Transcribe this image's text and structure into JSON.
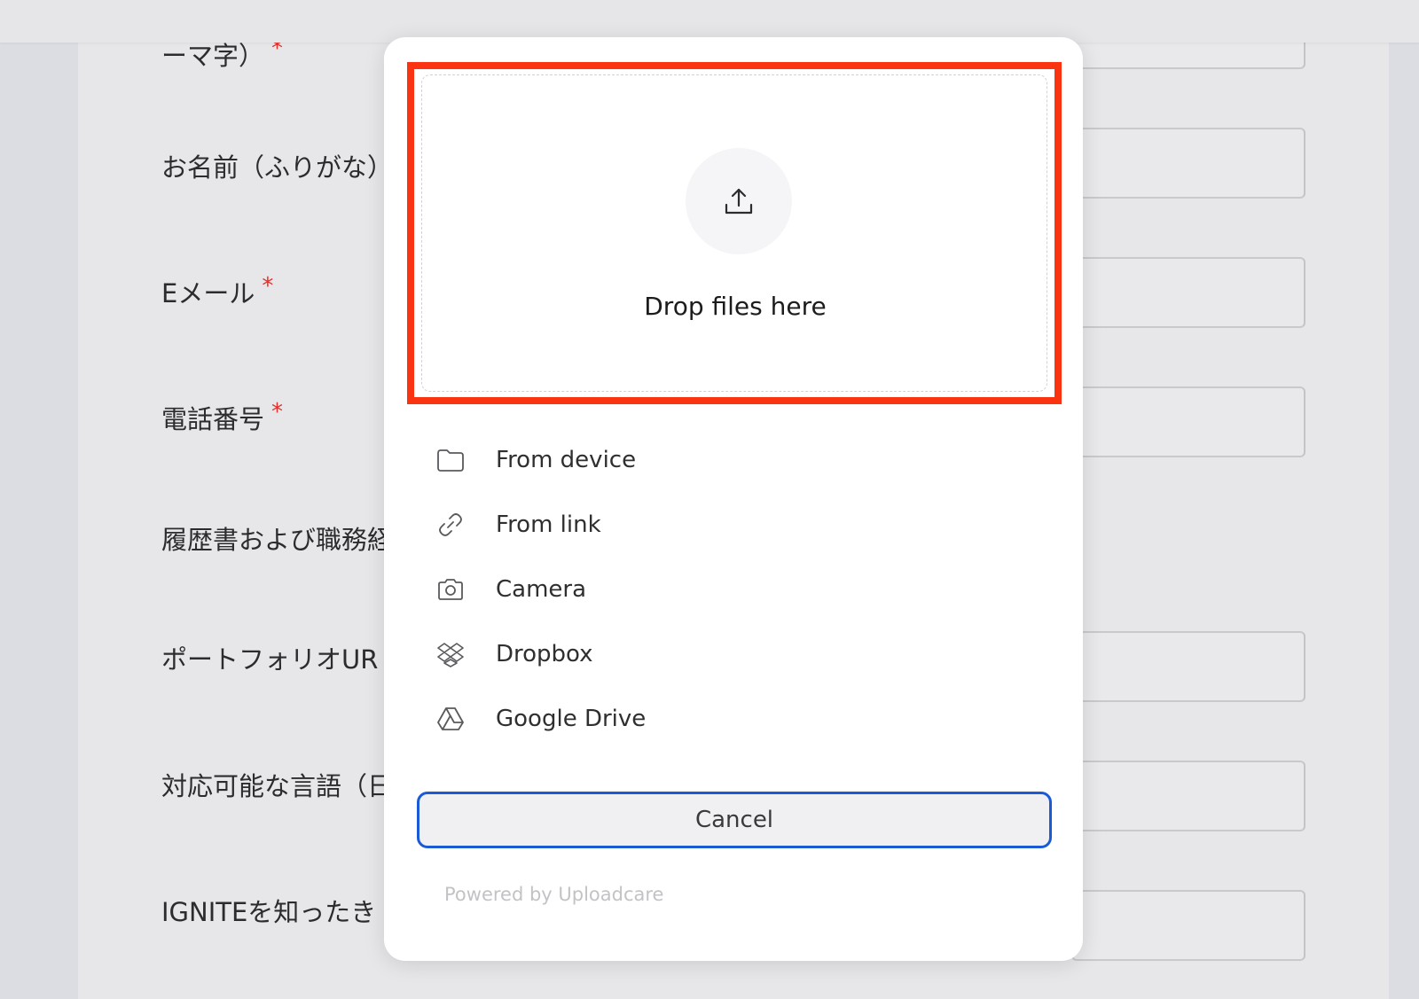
{
  "form": {
    "labels": [
      {
        "text": "ーマ字）",
        "required": true
      },
      {
        "text": "お名前（ふりがな）",
        "required": false
      },
      {
        "text": "Eメール",
        "required": true
      },
      {
        "text": "電話番号",
        "required": true
      },
      {
        "text": "履歴書および職務経",
        "required": false
      },
      {
        "text": "ポートフォリオUR",
        "required": false
      },
      {
        "text": "対応可能な言語（日",
        "required": false
      },
      {
        "text": "IGNITEを知ったき",
        "required": false
      }
    ],
    "required_mark": "*"
  },
  "uploader": {
    "drop_title": "Drop files here",
    "sources": [
      {
        "label": "From device",
        "icon": "folder-icon"
      },
      {
        "label": "From link",
        "icon": "link-icon"
      },
      {
        "label": "Camera",
        "icon": "camera-icon"
      },
      {
        "label": "Dropbox",
        "icon": "dropbox-icon"
      },
      {
        "label": "Google Drive",
        "icon": "google-drive-icon"
      }
    ],
    "cancel_label": "Cancel",
    "powered_by": "Powered by Uploadcare",
    "highlight_color": "#fa3311",
    "focus_color": "#1a5ad7"
  }
}
